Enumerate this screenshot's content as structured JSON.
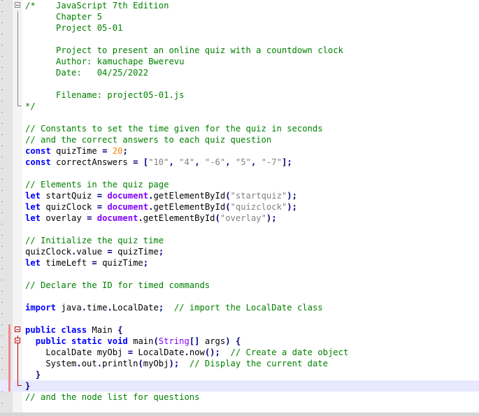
{
  "lines": [
    [
      [
        "c",
        "/*    JavaScript 7th Edition"
      ]
    ],
    [
      [
        "c",
        "      Chapter 5"
      ]
    ],
    [
      [
        "c",
        "      Project 05-01"
      ]
    ],
    [
      [
        "c",
        ""
      ]
    ],
    [
      [
        "c",
        "      Project to present an online quiz with a countdown clock"
      ]
    ],
    [
      [
        "c",
        "      Author: kamuchape Bwerevu"
      ]
    ],
    [
      [
        "c",
        "      Date:   04/25/2022"
      ]
    ],
    [
      [
        "c",
        ""
      ]
    ],
    [
      [
        "c",
        "      Filename: project05-01.js"
      ]
    ],
    [
      [
        "c",
        "*/"
      ]
    ],
    [],
    [
      [
        "c",
        "// Constants to set the time given for the quiz in seconds"
      ]
    ],
    [
      [
        "c",
        "// and the correct answers to each quiz question"
      ]
    ],
    [
      [
        "k",
        "const"
      ],
      [
        "i",
        " quizTime "
      ],
      [
        "o",
        "="
      ],
      [
        "i",
        " "
      ],
      [
        "n",
        "20"
      ],
      [
        "o",
        ";"
      ]
    ],
    [
      [
        "k",
        "const"
      ],
      [
        "i",
        " correctAnswers "
      ],
      [
        "o",
        "="
      ],
      [
        "i",
        " "
      ],
      [
        "o",
        "["
      ],
      [
        "s",
        "\"10\""
      ],
      [
        "o",
        ","
      ],
      [
        "i",
        " "
      ],
      [
        "s",
        "\"4\""
      ],
      [
        "o",
        ","
      ],
      [
        "i",
        " "
      ],
      [
        "s",
        "\"-6\""
      ],
      [
        "o",
        ","
      ],
      [
        "i",
        " "
      ],
      [
        "s",
        "\"5\""
      ],
      [
        "o",
        ","
      ],
      [
        "i",
        " "
      ],
      [
        "s",
        "\"-7\""
      ],
      [
        "o",
        "];"
      ]
    ],
    [],
    [
      [
        "c",
        "// Elements in the quiz page"
      ]
    ],
    [
      [
        "k",
        "let"
      ],
      [
        "i",
        " startQuiz "
      ],
      [
        "o",
        "="
      ],
      [
        "i",
        " "
      ],
      [
        "b",
        "document"
      ],
      [
        "o",
        "."
      ],
      [
        "i",
        "getElementById"
      ],
      [
        "o",
        "("
      ],
      [
        "s",
        "\"startquiz\""
      ],
      [
        "o",
        ");"
      ]
    ],
    [
      [
        "k",
        "let"
      ],
      [
        "i",
        " quizClock "
      ],
      [
        "o",
        "="
      ],
      [
        "i",
        " "
      ],
      [
        "b",
        "document"
      ],
      [
        "o",
        "."
      ],
      [
        "i",
        "getElementById"
      ],
      [
        "o",
        "("
      ],
      [
        "s",
        "\"quizclock\""
      ],
      [
        "o",
        ");"
      ]
    ],
    [
      [
        "k",
        "let"
      ],
      [
        "i",
        " overlay "
      ],
      [
        "o",
        "="
      ],
      [
        "i",
        " "
      ],
      [
        "b",
        "document"
      ],
      [
        "o",
        "."
      ],
      [
        "i",
        "getElementById"
      ],
      [
        "o",
        "("
      ],
      [
        "s",
        "\"overlay\""
      ],
      [
        "o",
        ");"
      ]
    ],
    [],
    [
      [
        "c",
        "// Initialize the quiz time"
      ]
    ],
    [
      [
        "i",
        "quizClock"
      ],
      [
        "o",
        "."
      ],
      [
        "i",
        "value "
      ],
      [
        "o",
        "="
      ],
      [
        "i",
        " quizTime"
      ],
      [
        "o",
        ";"
      ]
    ],
    [
      [
        "k",
        "let"
      ],
      [
        "i",
        " timeLeft "
      ],
      [
        "o",
        "="
      ],
      [
        "i",
        " quizTime"
      ],
      [
        "o",
        ";"
      ]
    ],
    [],
    [
      [
        "c",
        "// Declare the ID for timed commands"
      ]
    ],
    [],
    [
      [
        "k",
        "import"
      ],
      [
        "i",
        " java"
      ],
      [
        "o",
        "."
      ],
      [
        "i",
        "time"
      ],
      [
        "o",
        "."
      ],
      [
        "i",
        "LocalDate"
      ],
      [
        "o",
        ";"
      ],
      [
        "i",
        "  "
      ],
      [
        "c",
        "// import the LocalDate class"
      ]
    ],
    [],
    [
      [
        "k",
        "public class"
      ],
      [
        "i",
        " Main "
      ],
      [
        "o",
        "{"
      ]
    ],
    [
      [
        "i",
        "  "
      ],
      [
        "k",
        "public static void"
      ],
      [
        "i",
        " main"
      ],
      [
        "o",
        "("
      ],
      [
        "t",
        "String"
      ],
      [
        "o",
        "[]"
      ],
      [
        "i",
        " args"
      ],
      [
        "o",
        ")"
      ],
      [
        "i",
        " "
      ],
      [
        "o",
        "{"
      ]
    ],
    [
      [
        "i",
        "    LocalDate myObj "
      ],
      [
        "o",
        "="
      ],
      [
        "i",
        " LocalDate"
      ],
      [
        "o",
        "."
      ],
      [
        "i",
        "now"
      ],
      [
        "o",
        "();"
      ],
      [
        "i",
        "  "
      ],
      [
        "c",
        "// Create a date object"
      ]
    ],
    [
      [
        "i",
        "    System"
      ],
      [
        "o",
        "."
      ],
      [
        "i",
        "out"
      ],
      [
        "o",
        "."
      ],
      [
        "i",
        "println"
      ],
      [
        "o",
        "("
      ],
      [
        "i",
        "myObj"
      ],
      [
        "o",
        ");"
      ],
      [
        "i",
        "  "
      ],
      [
        "c",
        "// Display the current date"
      ]
    ],
    [
      [
        "i",
        "  "
      ],
      [
        "o",
        "}"
      ]
    ],
    [
      [
        "o",
        "}"
      ]
    ],
    [
      [
        "c",
        "// and the node list for questions"
      ]
    ]
  ]
}
